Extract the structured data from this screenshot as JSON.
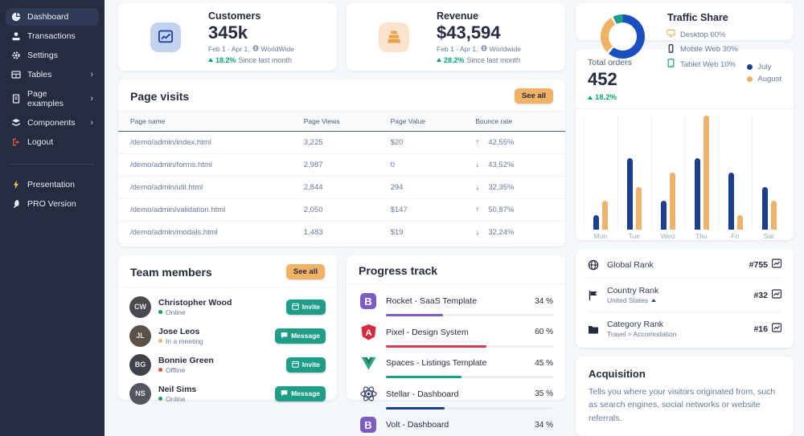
{
  "colors": {
    "accent_orange": "#f0b264",
    "teal": "#1f9d87",
    "green": "#05a677",
    "red_arrow": "#c0442f",
    "green_arrow": "#1f9d5f",
    "navy": "#262b40",
    "donut_blue": "#1b4fc0",
    "bar_blue": "#1c3e8f",
    "bar_orange": "#edb26b"
  },
  "sidebar": {
    "items": [
      {
        "label": "Dashboard",
        "icon": "pie-chart-icon",
        "active": true,
        "chevron": false
      },
      {
        "label": "Transactions",
        "icon": "transactions-icon",
        "active": false,
        "chevron": false
      },
      {
        "label": "Settings",
        "icon": "gear-icon",
        "active": false,
        "chevron": false
      },
      {
        "label": "Tables",
        "icon": "table-icon",
        "active": false,
        "chevron": true
      },
      {
        "label": "Page examples",
        "icon": "document-icon",
        "active": false,
        "chevron": true
      },
      {
        "label": "Components",
        "icon": "layers-icon",
        "active": false,
        "chevron": true
      },
      {
        "label": "Logout",
        "icon": "logout-icon",
        "active": false,
        "chevron": false
      }
    ],
    "secondary": [
      {
        "label": "Presentation",
        "icon": "lightning-icon"
      },
      {
        "label": "PRO Version",
        "icon": "rocket-icon"
      }
    ]
  },
  "stats": {
    "customers": {
      "title": "Customers",
      "value": "345k",
      "period": "Feb 1 - Apr 1,",
      "scope": "WorldWide",
      "change": "18.2%",
      "change_suffix": "Since last month"
    },
    "revenue": {
      "title": "Revenue",
      "value": "$43,594",
      "period": "Feb 1 - Apr 1,",
      "scope": "Worldwide",
      "change": "28.2%",
      "change_suffix": "Since last month"
    }
  },
  "traffic": {
    "title": "Traffic Share",
    "legend": [
      {
        "label": "Desktop 60%",
        "icon": "monitor-icon",
        "icon_color": "#edb26b"
      },
      {
        "label": "Mobile Web 30%",
        "icon": "smartphone-icon",
        "icon_color": "#262b40"
      },
      {
        "label": "Tablet Web 10%",
        "icon": "tablet-icon",
        "icon_color": "#1f9d87"
      }
    ]
  },
  "page_visits": {
    "title": "Page visits",
    "see_all": "See all",
    "headers": [
      "Page name",
      "Page Views",
      "Page Value",
      "Bounce rate"
    ],
    "rows": [
      {
        "name": "/demo/admin/index.html",
        "views": "3,225",
        "value": "$20",
        "bounce": "42,55%",
        "trend": "up"
      },
      {
        "name": "/demo/admin/forms.html",
        "views": "2,987",
        "value": "0",
        "bounce": "43,52%",
        "trend": "down"
      },
      {
        "name": "/demo/admin/util.html",
        "views": "2,844",
        "value": "294",
        "bounce": "32,35%",
        "trend": "down"
      },
      {
        "name": "/demo/admin/validation.html",
        "views": "2,050",
        "value": "$147",
        "bounce": "50,87%",
        "trend": "up"
      },
      {
        "name": "/demo/admin/modals.html",
        "views": "1,483",
        "value": "$19",
        "bounce": "32,24%",
        "trend": "down"
      }
    ]
  },
  "team": {
    "title": "Team members",
    "see_all": "See all",
    "members": [
      {
        "name": "Christopher Wood",
        "status": "Online",
        "status_color": "#1f9d5f",
        "action": "Invite",
        "action_icon": "calendar-icon",
        "avatar_bg": "#4a4a52",
        "initials": "CW"
      },
      {
        "name": "Jose Leos",
        "status": "In a meeting",
        "status_color": "#edb26b",
        "action": "Message",
        "action_icon": "chat-icon",
        "avatar_bg": "#5a524a",
        "initials": "JL"
      },
      {
        "name": "Bonnie Green",
        "status": "Offline",
        "status_color": "#e0533f",
        "action": "Invite",
        "action_icon": "calendar-icon",
        "avatar_bg": "#3f434b",
        "initials": "BG"
      },
      {
        "name": "Neil Sims",
        "status": "Online",
        "status_color": "#1f9d5f",
        "action": "Message",
        "action_icon": "chat-icon",
        "avatar_bg": "#52565e",
        "initials": "NS"
      }
    ]
  },
  "progress": {
    "title": "Progress track",
    "items": [
      {
        "label": "Rocket - SaaS Template",
        "percent": 34,
        "percent_label": "34 %",
        "color": "#7c5cc4",
        "icon": "bootstrap-icon"
      },
      {
        "label": "Pixel - Design System",
        "percent": 60,
        "percent_label": "60 %",
        "color": "#d63a52",
        "icon": "angular-icon"
      },
      {
        "label": "Spaces - Listings Template",
        "percent": 45,
        "percent_label": "45 %",
        "color": "#1f9d87",
        "icon": "vue-icon"
      },
      {
        "label": "Stellar - Dashboard",
        "percent": 35,
        "percent_label": "35 %",
        "color": "#1c3e8f",
        "icon": "react-icon"
      },
      {
        "label": "Volt - Dashboard",
        "percent": 34,
        "percent_label": "34 %",
        "color": "#7c5cc4",
        "icon": "bootstrap-icon"
      }
    ]
  },
  "total_orders": {
    "title": "Total orders",
    "value": "452",
    "change": "18.2%",
    "legend": [
      {
        "label": "July",
        "color": "#1c3e8f"
      },
      {
        "label": "August",
        "color": "#edb26b"
      }
    ]
  },
  "ranks": {
    "rows": [
      {
        "label": "Global Rank",
        "icon": "globe-icon",
        "sub": "",
        "value": "#755"
      },
      {
        "label": "Country Rank",
        "icon": "flag-icon",
        "sub": "United States",
        "caret": true,
        "value": "#32"
      },
      {
        "label": "Category Rank",
        "icon": "folder-icon",
        "sub": "Travel > Accomodation",
        "value": "#16"
      }
    ]
  },
  "acquisition": {
    "title": "Acquisition",
    "body": "Tells you where your visitors originated from, such as search engines, social networks or website referrals."
  },
  "chart_data": [
    {
      "type": "pie",
      "title": "Traffic Share",
      "labels": [
        "Desktop",
        "Mobile Web",
        "Tablet Web"
      ],
      "values": [
        60,
        30,
        10
      ],
      "colors": [
        "#1b4fc0",
        "#f0b264",
        "#1f9d87"
      ],
      "legend_position": "right",
      "donut": true
    },
    {
      "type": "bar",
      "title": "Total orders",
      "categories": [
        "Mon",
        "Tue",
        "Wed",
        "Thu",
        "Fri",
        "Sat"
      ],
      "series": [
        {
          "name": "July",
          "values": [
            1,
            5,
            2,
            5,
            4,
            3
          ],
          "color": "#1c3e8f"
        },
        {
          "name": "August",
          "values": [
            2,
            3,
            4,
            8,
            1,
            2
          ],
          "color": "#edb26b"
        }
      ],
      "ylim": [
        0,
        8
      ],
      "grid": "vertical",
      "legend_position": "top-right"
    }
  ]
}
